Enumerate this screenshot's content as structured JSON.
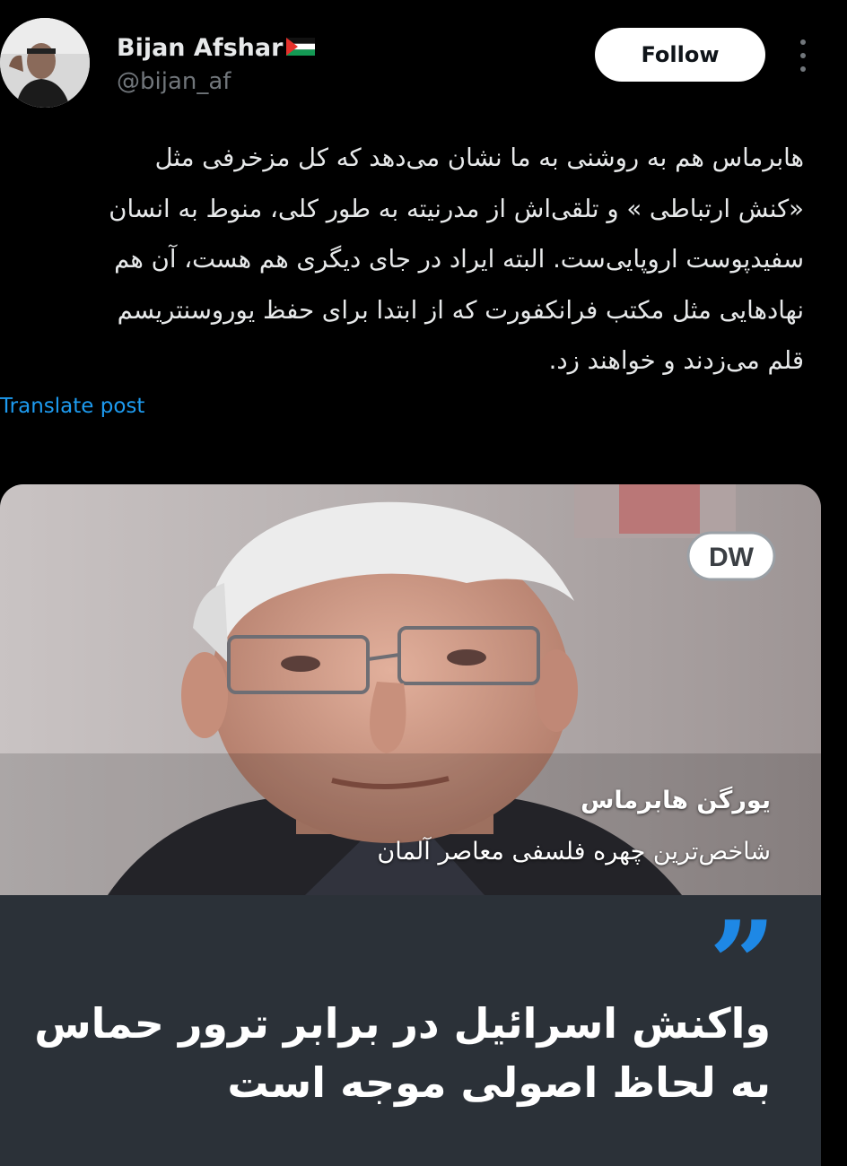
{
  "author": {
    "display_name": "Bijan Afshar",
    "handle": "@bijan_af",
    "flag_icon": "palestine-flag-icon"
  },
  "follow_label": "Follow",
  "post": {
    "lines": [
      "هابرماس هم به روشنی به ما نشان می‌دهد که کل مزخرفی مثل",
      "«کنش ارتباطی » و تلقی‌اش از مدرنیته به طور کلی، منوط به انسان",
      "سفیدپوست اروپایی‌ست. البته ایراد در جای دیگری هم هست، آن هم",
      "نهادهایی مثل مکتب فرانکفورت که از ابتدا برای حفظ یوروسنتریسم",
      "قلم می‌زدند و خواهند زد."
    ]
  },
  "translate_label": "Translate post",
  "card": {
    "logo_text": "DW",
    "caption_name": "یورگن هابرماس",
    "caption_role": "شاخص‌ترین چهره فلسفی معاصر آلمان",
    "quote_mark": "”",
    "headline_lines": [
      "واکنش اسرائیل در برابر ترور حماس",
      "به لحاظ اصولی موجه است"
    ],
    "accent_color": "#1e88e5",
    "panel_color": "#2b3138"
  }
}
